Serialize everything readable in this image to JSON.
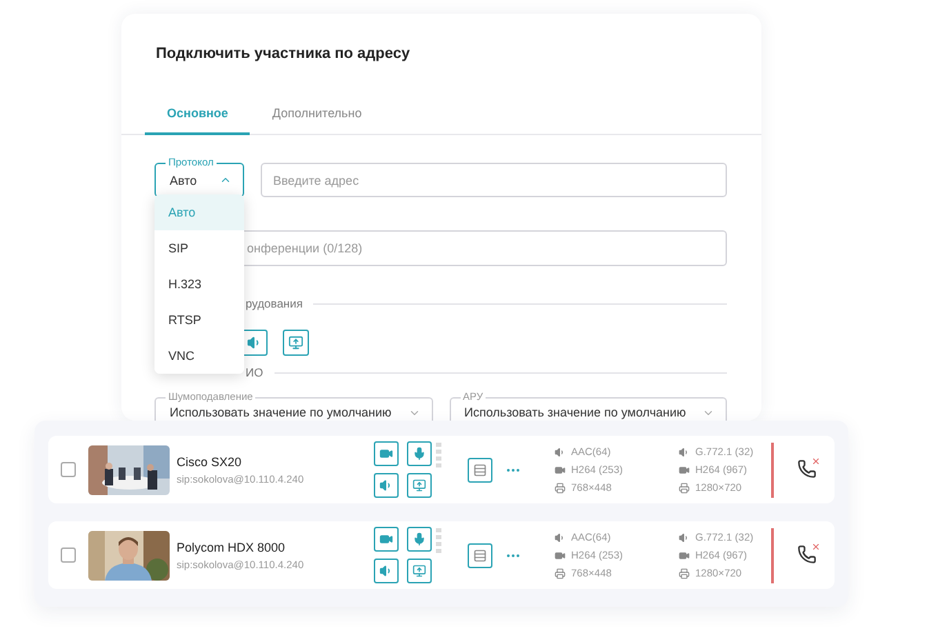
{
  "dialog": {
    "title": "Подключить участника по адресу",
    "tabs": [
      {
        "label": "Основное",
        "selected": true
      },
      {
        "label": "Дополнительно",
        "selected": false
      }
    ],
    "protocol": {
      "label": "Протокол",
      "value": "Авто",
      "expanded": true,
      "options": [
        {
          "label": "Авто",
          "selected": true
        },
        {
          "label": "SIP",
          "selected": false
        },
        {
          "label": "H.323",
          "selected": false
        },
        {
          "label": "RTSP",
          "selected": false
        },
        {
          "label": "VNC",
          "selected": false
        }
      ]
    },
    "address": {
      "placeholder": "Введите адрес"
    },
    "conference_name": {
      "placeholder": "онференции (0/128)"
    },
    "equipment_section": {
      "title": "рудования"
    },
    "audio_section": {
      "title": "ИО"
    },
    "selects": [
      {
        "label": "Шумоподавление",
        "value": "Использовать значение по умолчанию"
      },
      {
        "label": "АРУ",
        "value": "Использовать значение по умолчанию"
      }
    ]
  },
  "participants": [
    {
      "name": "Cisco SX20",
      "address": "sip:sokolova@10.110.4.240",
      "checked": false,
      "stats_in": [
        {
          "kind": "audio",
          "text": "AAC(64)"
        },
        {
          "kind": "video",
          "text": "H264 (253)"
        },
        {
          "kind": "resolution",
          "text": "768×448"
        }
      ],
      "stats_out": [
        {
          "kind": "audio",
          "text": "G.772.1 (32)"
        },
        {
          "kind": "video",
          "text": "H264 (967)"
        },
        {
          "kind": "resolution",
          "text": "1280×720"
        }
      ]
    },
    {
      "name": "Polycom HDX 8000",
      "address": "sip:sokolova@10.110.4.240",
      "checked": false,
      "stats_in": [
        {
          "kind": "audio",
          "text": "AAC(64)"
        },
        {
          "kind": "video",
          "text": "H264 (253)"
        },
        {
          "kind": "resolution",
          "text": "768×448"
        }
      ],
      "stats_out": [
        {
          "kind": "audio",
          "text": "G.772.1 (32)"
        },
        {
          "kind": "video",
          "text": "H264 (967)"
        },
        {
          "kind": "resolution",
          "text": "1280×720"
        }
      ]
    }
  ]
}
